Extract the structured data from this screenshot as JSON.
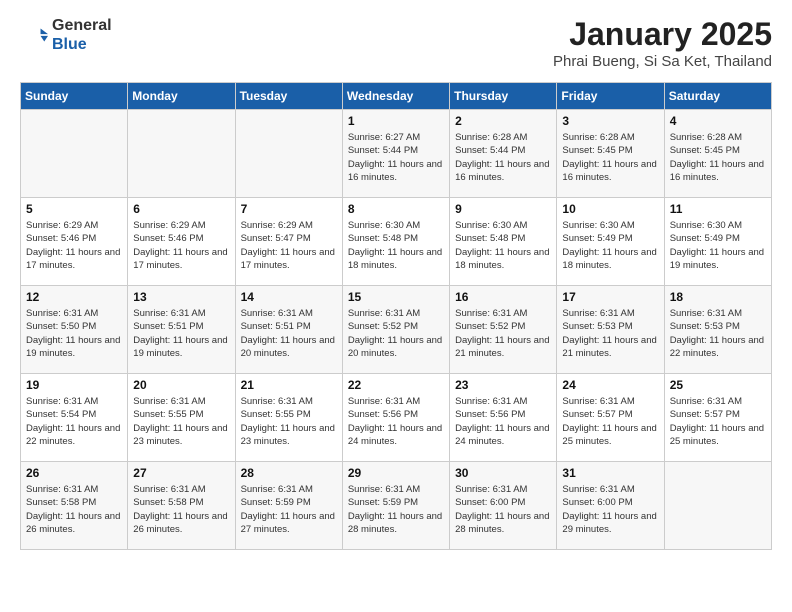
{
  "header": {
    "logo": {
      "general": "General",
      "blue": "Blue"
    },
    "title": "January 2025",
    "location": "Phrai Bueng, Si Sa Ket, Thailand"
  },
  "weekdays": [
    "Sunday",
    "Monday",
    "Tuesday",
    "Wednesday",
    "Thursday",
    "Friday",
    "Saturday"
  ],
  "weeks": [
    [
      {
        "day": "",
        "sunrise": "",
        "sunset": "",
        "daylight": ""
      },
      {
        "day": "",
        "sunrise": "",
        "sunset": "",
        "daylight": ""
      },
      {
        "day": "",
        "sunrise": "",
        "sunset": "",
        "daylight": ""
      },
      {
        "day": "1",
        "sunrise": "Sunrise: 6:27 AM",
        "sunset": "Sunset: 5:44 PM",
        "daylight": "Daylight: 11 hours and 16 minutes."
      },
      {
        "day": "2",
        "sunrise": "Sunrise: 6:28 AM",
        "sunset": "Sunset: 5:44 PM",
        "daylight": "Daylight: 11 hours and 16 minutes."
      },
      {
        "day": "3",
        "sunrise": "Sunrise: 6:28 AM",
        "sunset": "Sunset: 5:45 PM",
        "daylight": "Daylight: 11 hours and 16 minutes."
      },
      {
        "day": "4",
        "sunrise": "Sunrise: 6:28 AM",
        "sunset": "Sunset: 5:45 PM",
        "daylight": "Daylight: 11 hours and 16 minutes."
      }
    ],
    [
      {
        "day": "5",
        "sunrise": "Sunrise: 6:29 AM",
        "sunset": "Sunset: 5:46 PM",
        "daylight": "Daylight: 11 hours and 17 minutes."
      },
      {
        "day": "6",
        "sunrise": "Sunrise: 6:29 AM",
        "sunset": "Sunset: 5:46 PM",
        "daylight": "Daylight: 11 hours and 17 minutes."
      },
      {
        "day": "7",
        "sunrise": "Sunrise: 6:29 AM",
        "sunset": "Sunset: 5:47 PM",
        "daylight": "Daylight: 11 hours and 17 minutes."
      },
      {
        "day": "8",
        "sunrise": "Sunrise: 6:30 AM",
        "sunset": "Sunset: 5:48 PM",
        "daylight": "Daylight: 11 hours and 18 minutes."
      },
      {
        "day": "9",
        "sunrise": "Sunrise: 6:30 AM",
        "sunset": "Sunset: 5:48 PM",
        "daylight": "Daylight: 11 hours and 18 minutes."
      },
      {
        "day": "10",
        "sunrise": "Sunrise: 6:30 AM",
        "sunset": "Sunset: 5:49 PM",
        "daylight": "Daylight: 11 hours and 18 minutes."
      },
      {
        "day": "11",
        "sunrise": "Sunrise: 6:30 AM",
        "sunset": "Sunset: 5:49 PM",
        "daylight": "Daylight: 11 hours and 19 minutes."
      }
    ],
    [
      {
        "day": "12",
        "sunrise": "Sunrise: 6:31 AM",
        "sunset": "Sunset: 5:50 PM",
        "daylight": "Daylight: 11 hours and 19 minutes."
      },
      {
        "day": "13",
        "sunrise": "Sunrise: 6:31 AM",
        "sunset": "Sunset: 5:51 PM",
        "daylight": "Daylight: 11 hours and 19 minutes."
      },
      {
        "day": "14",
        "sunrise": "Sunrise: 6:31 AM",
        "sunset": "Sunset: 5:51 PM",
        "daylight": "Daylight: 11 hours and 20 minutes."
      },
      {
        "day": "15",
        "sunrise": "Sunrise: 6:31 AM",
        "sunset": "Sunset: 5:52 PM",
        "daylight": "Daylight: 11 hours and 20 minutes."
      },
      {
        "day": "16",
        "sunrise": "Sunrise: 6:31 AM",
        "sunset": "Sunset: 5:52 PM",
        "daylight": "Daylight: 11 hours and 21 minutes."
      },
      {
        "day": "17",
        "sunrise": "Sunrise: 6:31 AM",
        "sunset": "Sunset: 5:53 PM",
        "daylight": "Daylight: 11 hours and 21 minutes."
      },
      {
        "day": "18",
        "sunrise": "Sunrise: 6:31 AM",
        "sunset": "Sunset: 5:53 PM",
        "daylight": "Daylight: 11 hours and 22 minutes."
      }
    ],
    [
      {
        "day": "19",
        "sunrise": "Sunrise: 6:31 AM",
        "sunset": "Sunset: 5:54 PM",
        "daylight": "Daylight: 11 hours and 22 minutes."
      },
      {
        "day": "20",
        "sunrise": "Sunrise: 6:31 AM",
        "sunset": "Sunset: 5:55 PM",
        "daylight": "Daylight: 11 hours and 23 minutes."
      },
      {
        "day": "21",
        "sunrise": "Sunrise: 6:31 AM",
        "sunset": "Sunset: 5:55 PM",
        "daylight": "Daylight: 11 hours and 23 minutes."
      },
      {
        "day": "22",
        "sunrise": "Sunrise: 6:31 AM",
        "sunset": "Sunset: 5:56 PM",
        "daylight": "Daylight: 11 hours and 24 minutes."
      },
      {
        "day": "23",
        "sunrise": "Sunrise: 6:31 AM",
        "sunset": "Sunset: 5:56 PM",
        "daylight": "Daylight: 11 hours and 24 minutes."
      },
      {
        "day": "24",
        "sunrise": "Sunrise: 6:31 AM",
        "sunset": "Sunset: 5:57 PM",
        "daylight": "Daylight: 11 hours and 25 minutes."
      },
      {
        "day": "25",
        "sunrise": "Sunrise: 6:31 AM",
        "sunset": "Sunset: 5:57 PM",
        "daylight": "Daylight: 11 hours and 25 minutes."
      }
    ],
    [
      {
        "day": "26",
        "sunrise": "Sunrise: 6:31 AM",
        "sunset": "Sunset: 5:58 PM",
        "daylight": "Daylight: 11 hours and 26 minutes."
      },
      {
        "day": "27",
        "sunrise": "Sunrise: 6:31 AM",
        "sunset": "Sunset: 5:58 PM",
        "daylight": "Daylight: 11 hours and 26 minutes."
      },
      {
        "day": "28",
        "sunrise": "Sunrise: 6:31 AM",
        "sunset": "Sunset: 5:59 PM",
        "daylight": "Daylight: 11 hours and 27 minutes."
      },
      {
        "day": "29",
        "sunrise": "Sunrise: 6:31 AM",
        "sunset": "Sunset: 5:59 PM",
        "daylight": "Daylight: 11 hours and 28 minutes."
      },
      {
        "day": "30",
        "sunrise": "Sunrise: 6:31 AM",
        "sunset": "Sunset: 6:00 PM",
        "daylight": "Daylight: 11 hours and 28 minutes."
      },
      {
        "day": "31",
        "sunrise": "Sunrise: 6:31 AM",
        "sunset": "Sunset: 6:00 PM",
        "daylight": "Daylight: 11 hours and 29 minutes."
      },
      {
        "day": "",
        "sunrise": "",
        "sunset": "",
        "daylight": ""
      }
    ]
  ]
}
